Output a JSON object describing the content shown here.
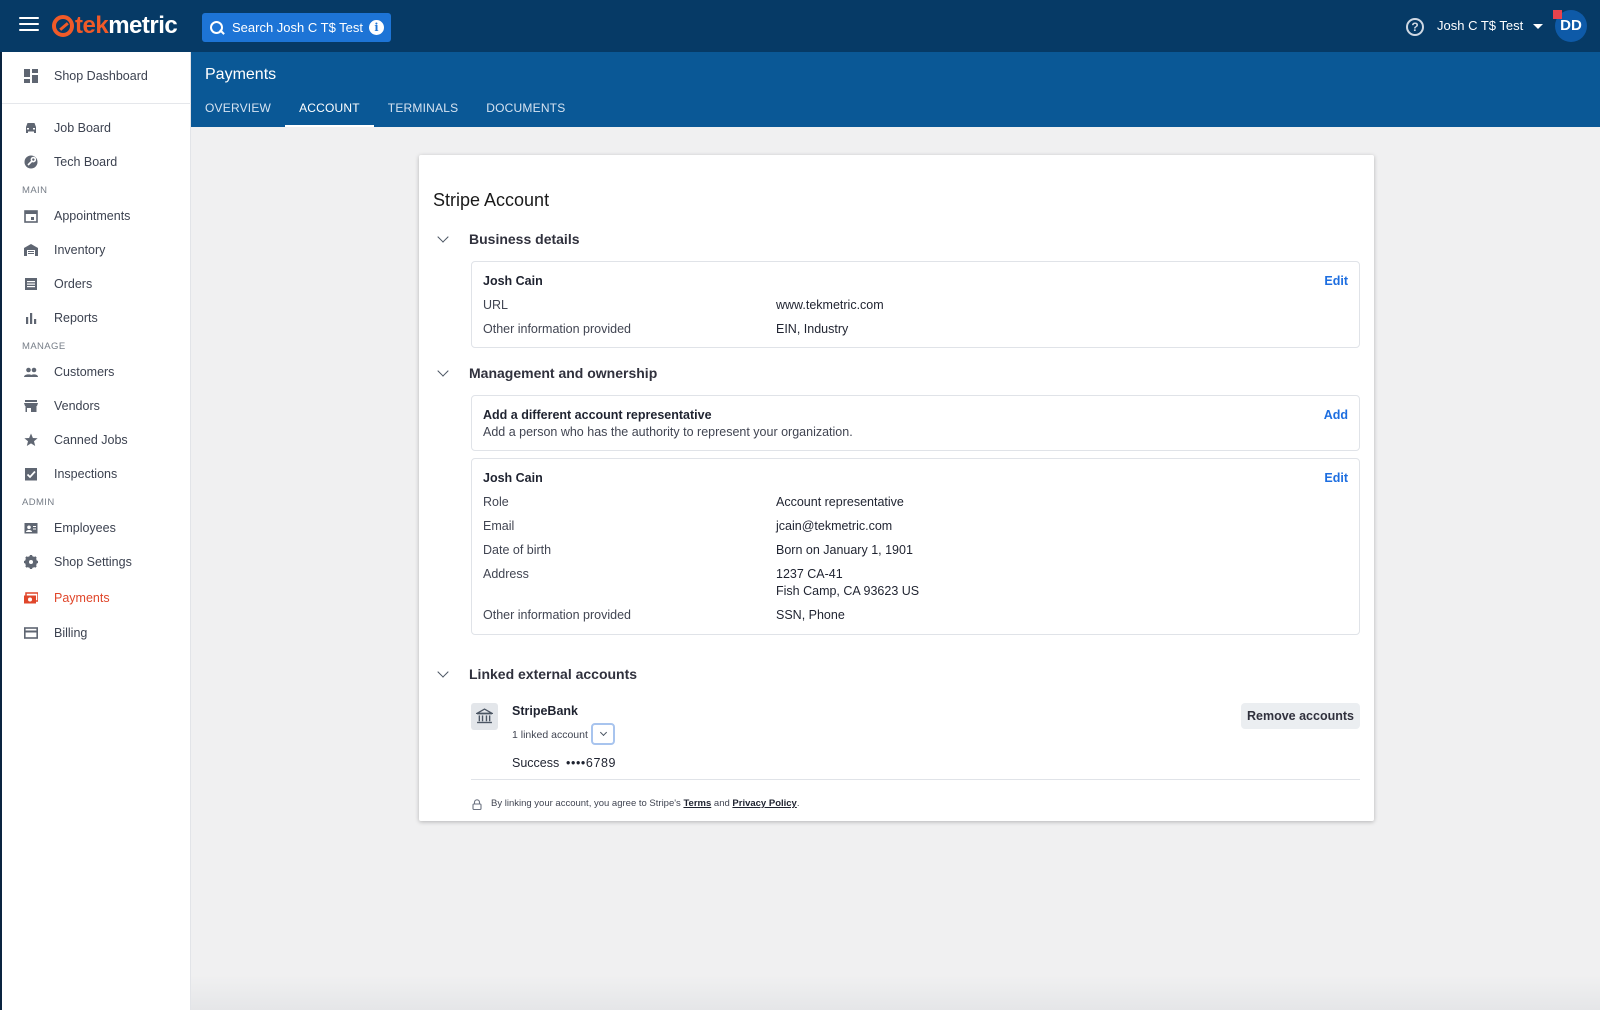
{
  "topbar": {
    "logo_part1": "tek",
    "logo_part2": "metric",
    "search_placeholder": "Search Josh C T$ Test",
    "help_glyph": "?",
    "user_name": "Josh C T$ Test",
    "avatar_initials": "DD"
  },
  "sidebar": {
    "dashboard": "Shop Dashboard",
    "top_items": [
      "Job Board",
      "Tech Board"
    ],
    "sections": {
      "main": "MAIN",
      "manage": "MANAGE",
      "admin": "ADMIN"
    },
    "main_items": [
      "Appointments",
      "Inventory",
      "Orders",
      "Reports"
    ],
    "manage_items": [
      "Customers",
      "Vendors",
      "Canned Jobs",
      "Inspections"
    ],
    "admin_items": [
      "Employees",
      "Shop Settings",
      "Payments",
      "Billing"
    ],
    "active_item": "Payments"
  },
  "page": {
    "title": "Payments",
    "tabs": [
      "OVERVIEW",
      "ACCOUNT",
      "TERMINALS",
      "DOCUMENTS"
    ],
    "active_tab": "ACCOUNT"
  },
  "card": {
    "title": "Stripe Account",
    "business": {
      "heading": "Business details",
      "name": "Josh Cain",
      "edit_label": "Edit",
      "rows": [
        {
          "label": "URL",
          "value": "www.tekmetric.com"
        },
        {
          "label": "Other information provided",
          "value": "EIN, Industry"
        }
      ]
    },
    "management": {
      "heading": "Management and ownership",
      "add_rep_title": "Add a different account representative",
      "add_rep_desc": "Add a person who has the authority to represent your organization.",
      "add_label": "Add",
      "person_name": "Josh Cain",
      "edit_label": "Edit",
      "rows": [
        {
          "label": "Role",
          "value": "Account representative"
        },
        {
          "label": "Email",
          "value": "jcain@tekmetric.com"
        },
        {
          "label": "Date of birth",
          "value": "Born on January 1, 1901"
        },
        {
          "label": "Address",
          "value": "1237 CA-41",
          "value2": "Fish Camp, CA 93623 US"
        },
        {
          "label": "Other information provided",
          "value": "SSN, Phone"
        }
      ]
    },
    "linked": {
      "heading": "Linked external accounts",
      "bank_name": "StripeBank",
      "linked_count": "1 linked account",
      "account_status": "Success",
      "account_mask": "••••6789",
      "remove_label": "Remove accounts",
      "terms_prefix": "By linking your account, you agree to Stripe's ",
      "terms_link": "Terms",
      "terms_and": " and ",
      "privacy_link": "Privacy Policy",
      "terms_suffix": "."
    }
  },
  "colors": {
    "topbar": "#063a66",
    "header": "#0a5896",
    "accent_orange": "#e0462a",
    "link_blue": "#1d6ee0"
  }
}
